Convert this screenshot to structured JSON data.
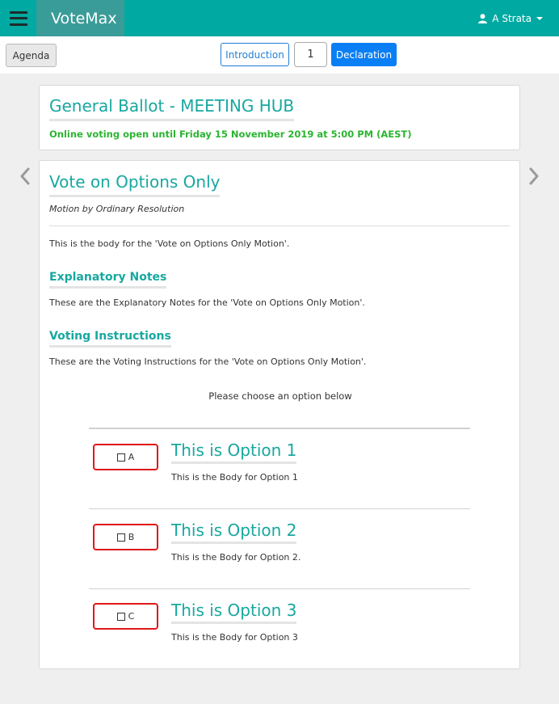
{
  "app": {
    "brand": "VoteMax",
    "user_name": "A Strata",
    "icons": {
      "menu": "hamburger-icon",
      "user": "user-icon",
      "prev": "chevron-left-icon",
      "next": "chevron-right-icon"
    }
  },
  "toolbar": {
    "agenda_label": "Agenda",
    "intro_label": "Introduction",
    "page_number": "1",
    "declaration_label": "Declaration"
  },
  "meeting": {
    "title": "General Ballot - MEETING HUB",
    "voting_open": "Online voting open until Friday 15 November 2019 at 5:00 PM (AEST)"
  },
  "motion": {
    "title": "Vote on Options Only",
    "subtitle": "Motion by Ordinary Resolution",
    "body": "This is the body for the 'Vote on Options Only Motion'.",
    "notes_heading": "Explanatory Notes",
    "notes_body": "These are the Explanatory Notes for the 'Vote on Options Only Motion'.",
    "instructions_heading": "Voting Instructions",
    "instructions_body": "These are the Voting Instructions for the 'Vote on Options Only Motion'.",
    "choose_prompt": "Please choose an option below",
    "options": [
      {
        "letter": "A",
        "title": "This is Option 1",
        "body": "This is the Body for Option 1"
      },
      {
        "letter": "B",
        "title": "This is Option 2",
        "body": "This is the Body for Option 2."
      },
      {
        "letter": "C",
        "title": "This is Option 3",
        "body": "This is the Body for Option 3"
      }
    ]
  },
  "colors": {
    "topbar": "#00a9a1",
    "accent_teal": "#17a8a0",
    "open_green": "#2bb530",
    "primary_blue": "#0a7ff5",
    "option_border_red": "#e01818"
  }
}
